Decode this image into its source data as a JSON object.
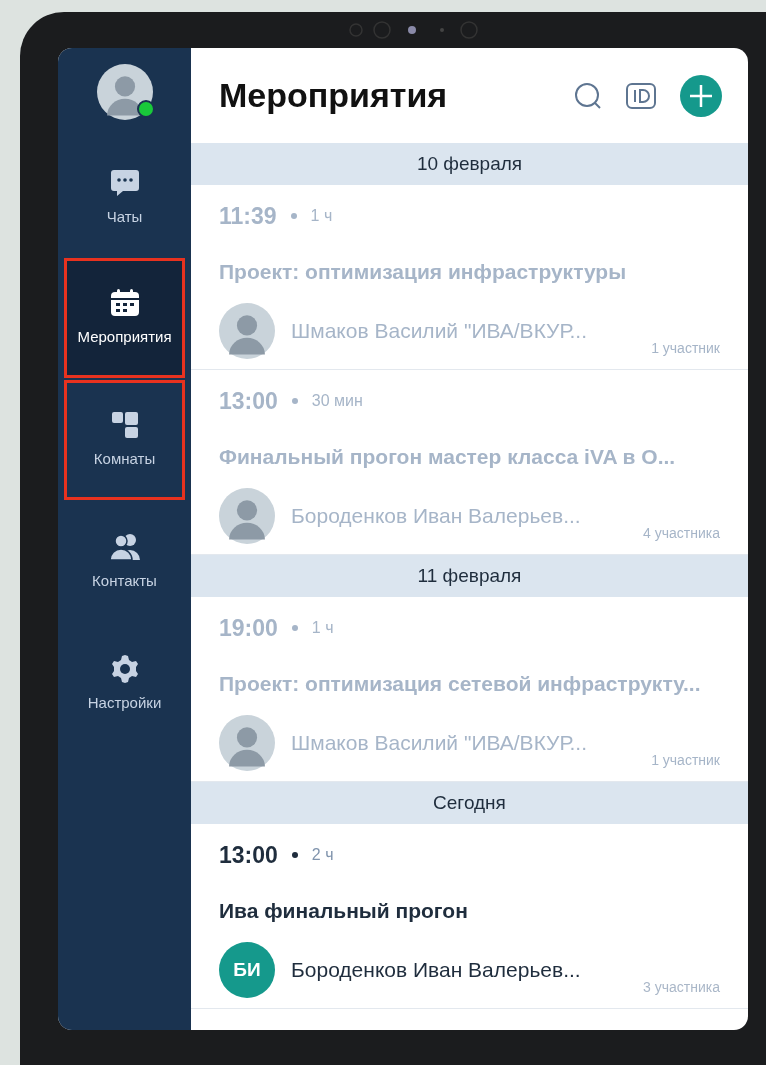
{
  "sidebar": {
    "profile": {
      "online": true
    },
    "items": [
      {
        "kind": "chats",
        "label": "Чаты",
        "selected": false,
        "highlighted": false
      },
      {
        "kind": "events",
        "label": "Мероприятия",
        "selected": true,
        "highlighted": true
      },
      {
        "kind": "rooms",
        "label": "Комнаты",
        "selected": false,
        "highlighted": true
      },
      {
        "kind": "contacts",
        "label": "Контакты",
        "selected": false,
        "highlighted": false
      },
      {
        "kind": "settings",
        "label": "Настройки",
        "selected": false,
        "highlighted": false
      }
    ]
  },
  "header": {
    "title": "Мероприятия"
  },
  "sections": [
    {
      "date": "10 февраля",
      "events": [
        {
          "time": "11:39",
          "duration": "1 ч",
          "title": "Проект: оптимизация инфраструктуры",
          "organizer": "Шмаков Василий \"ИВА/ВКУР...",
          "avatar": {
            "kind": "photo"
          },
          "participants": "1 участник",
          "past": true
        },
        {
          "time": "13:00",
          "duration": "30 мин",
          "title": "Финальный прогон мастер класса iVA в О...",
          "organizer": "Бороденков Иван Валерьев...",
          "avatar": {
            "kind": "photo"
          },
          "participants": "4 участника",
          "past": true
        }
      ]
    },
    {
      "date": "11 февраля",
      "events": [
        {
          "time": "19:00",
          "duration": "1 ч",
          "title": "Проект: оптимизация сетевой инфраструкту...",
          "organizer": "Шмаков Василий \"ИВА/ВКУР...",
          "avatar": {
            "kind": "photo"
          },
          "participants": "1 участник",
          "past": true
        }
      ]
    },
    {
      "date": "Сегодня",
      "events": [
        {
          "time": "13:00",
          "duration": "2 ч",
          "title": "Ива финальный прогон",
          "organizer": "Бороденков Иван Валерьев...",
          "avatar": {
            "kind": "initials",
            "initials": "БИ",
            "color": "#15998c"
          },
          "participants": "3 участника",
          "past": false
        }
      ]
    }
  ]
}
